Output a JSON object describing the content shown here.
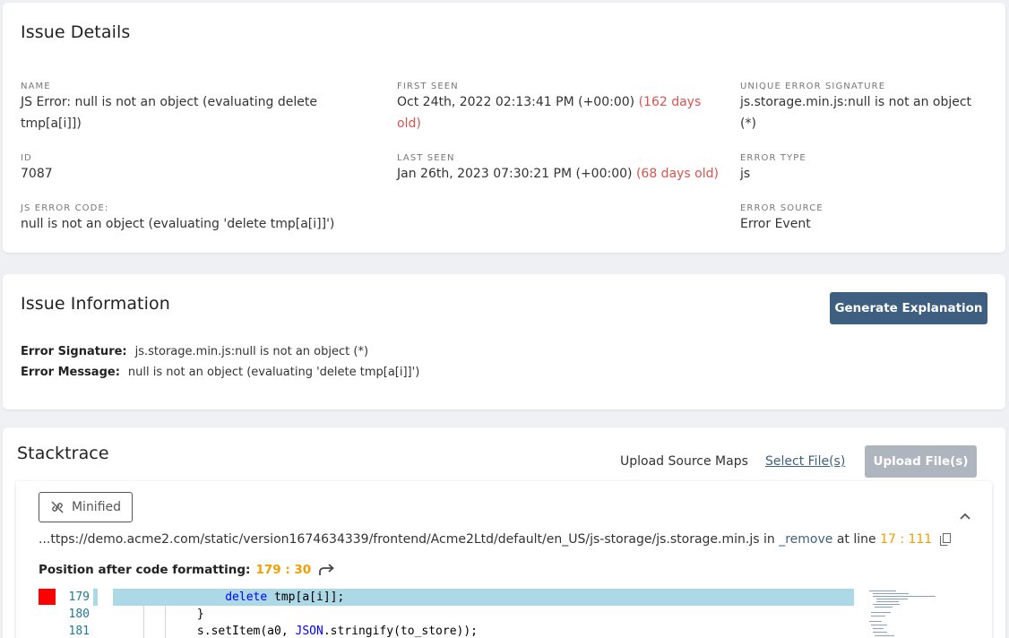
{
  "issue_details": {
    "title": "Issue Details",
    "name_label": "NAME",
    "name_value": "JS Error: null is not an object (evaluating delete tmp[a[i]])",
    "id_label": "ID",
    "id_value": "7087",
    "js_error_code_label": "JS ERROR CODE:",
    "js_error_code_value": "null is not an object (evaluating 'delete tmp[a[i]]')",
    "first_seen_label": "FIRST SEEN",
    "first_seen_value": "Oct 24th, 2022 02:13:41 PM (+00:00)",
    "first_seen_age": "(162 days old)",
    "last_seen_label": "LAST SEEN",
    "last_seen_value": "Jan 26th, 2023 07:30:21 PM (+00:00)",
    "last_seen_age": "(68 days old)",
    "signature_label": "UNIQUE ERROR SIGNATURE",
    "signature_value": "js.storage.min.js:null is not an object (*)",
    "error_type_label": "ERROR TYPE",
    "error_type_value": "js",
    "error_source_label": "ERROR SOURCE",
    "error_source_value": "Error Event"
  },
  "issue_information": {
    "title": "Issue Information",
    "generate_button": "Generate Explanation",
    "signature_label": "Error Signature:",
    "signature_value": "js.storage.min.js:null is not an object (*)",
    "message_label": "Error Message:",
    "message_value": "null is not an object (evaluating 'delete tmp[a[i]]')"
  },
  "stacktrace": {
    "title": "Stacktrace",
    "upload_label": "Upload Source Maps",
    "select_files": "Select File(s)",
    "upload_button": "Upload File(s)",
    "minified_button": "Minified",
    "path": "...ttps://demo.acme2.com/static/version1674634339/frontend/Acme2Ltd/default/en_US/js-storage/js.storage.min.js",
    "in_text": "in",
    "function_name": "_remove",
    "at_line_text": "at line",
    "location": "17 : 111",
    "position_label": "Position after code formatting:",
    "position_value": "179 : 30",
    "code_lines": [
      {
        "num": "179",
        "pre": "                ",
        "kw": "delete",
        "post": " tmp[a[i]];"
      },
      {
        "num": "180",
        "pre": "            }",
        "kw": "",
        "post": ""
      },
      {
        "num": "181",
        "pre": "            s.setItem(a0, ",
        "kw": "JSON",
        "post": ".stringify(to_store));"
      }
    ]
  },
  "colors": {
    "accent": "#3e5f80",
    "warning_red": "#d9534f",
    "location_orange": "#f0a000",
    "highlight": "#add8e6",
    "error_marker": "#ff0000"
  }
}
